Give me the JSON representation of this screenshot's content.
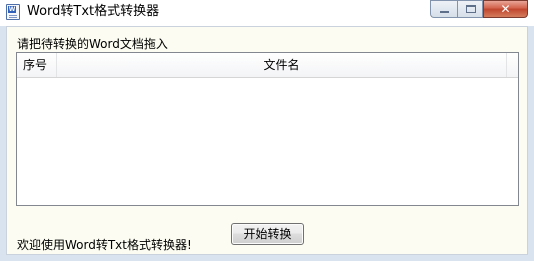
{
  "window": {
    "title": "Word转Txt格式转换器",
    "icon": "word-document-icon",
    "controls": {
      "minimize": "minimize-icon",
      "maximize": "maximize-icon",
      "close": "✕"
    }
  },
  "main": {
    "instruction": "请把待转换的Word文档拖入",
    "list": {
      "columns": [
        "序号",
        "文件名"
      ],
      "rows": []
    },
    "start_button_label": "开始转换",
    "welcome_text": "欢迎使用Word转Txt格式转换器!"
  },
  "colors": {
    "client_background": "#fcfcf2",
    "close_button": "#c0452e"
  }
}
